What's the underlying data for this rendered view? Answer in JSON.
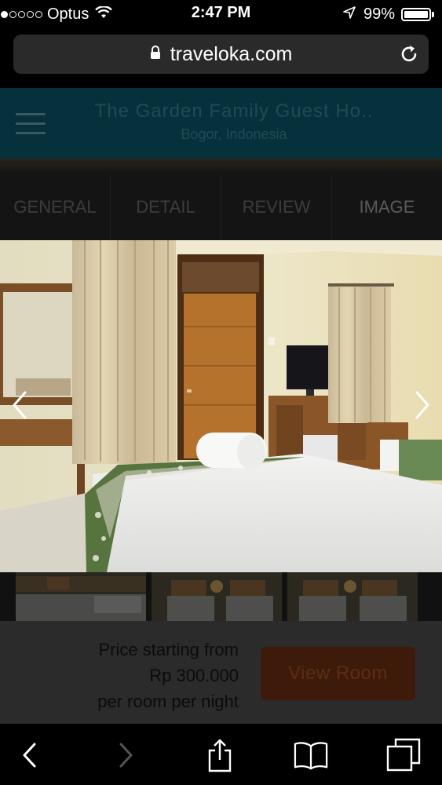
{
  "status_bar": {
    "signal_bars_filled": 1,
    "signal_bars_total": 5,
    "carrier": "Optus",
    "time": "2:47 PM",
    "battery_percent": "99%",
    "battery_level": 0.99,
    "icons": [
      "wifi-icon",
      "location-arrow-icon",
      "battery-icon"
    ]
  },
  "browser": {
    "url": "traveloka.com",
    "icons": [
      "lock-icon",
      "reload-icon"
    ]
  },
  "header": {
    "title": "The Garden Family Guest Ho..",
    "location": "Bogor, Indonesia",
    "menu_icon": "hamburger-icon"
  },
  "tabs": [
    {
      "label": "GENERAL"
    },
    {
      "label": "DETAIL"
    },
    {
      "label": "REVIEW"
    },
    {
      "label": "IMAGE",
      "active": true
    }
  ],
  "gallery": {
    "main_image": "hotel room photo with beds, towel, TV and curtains",
    "prev_icon": "chevron-left-icon",
    "next_icon": "chevron-right-icon",
    "thumbnail_count": 3
  },
  "pricing": {
    "line1": "Price starting from",
    "amount": "Rp 300.000",
    "line3": "per room per night",
    "button_label": "View Room"
  },
  "toolbar": {
    "icons": [
      "back-icon",
      "forward-icon",
      "share-icon",
      "bookmarks-icon",
      "tabs-icon"
    ]
  },
  "colors": {
    "header_bg": "#06303c",
    "button_bg": "#3e1a0a",
    "overlay_bg": "#2b2b2b"
  }
}
